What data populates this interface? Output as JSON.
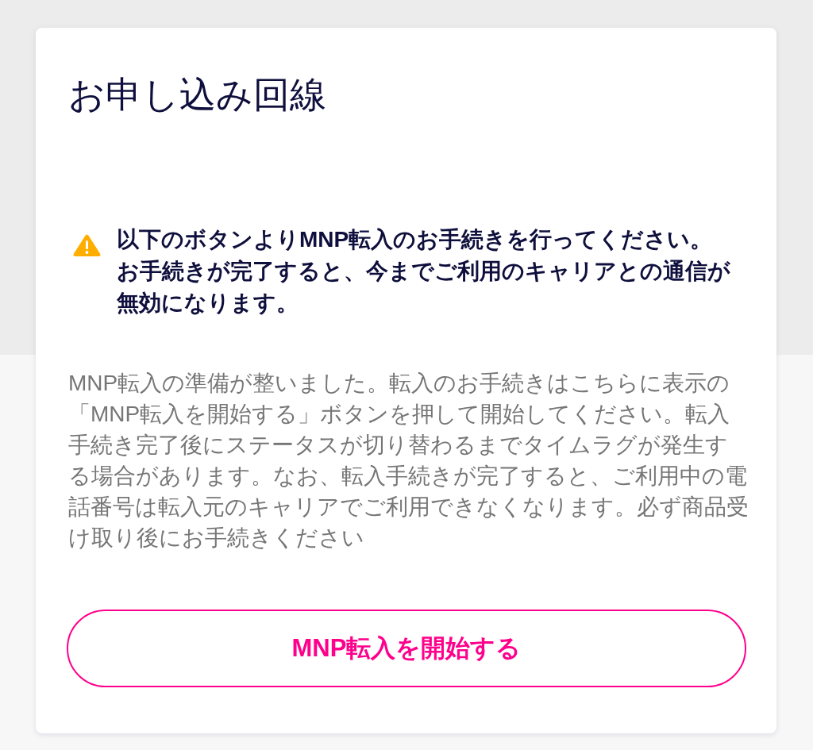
{
  "title": "お申し込み回線",
  "warning": {
    "lines": [
      "以下のボタンよりMNP転入のお手続きを行ってください。",
      "お手続きが完了すると、今までご利用のキャリアとの通信が無効になります。"
    ]
  },
  "description": "MNP転入の準備が整いました。転入のお手続きはこちらに表示の「MNP転入を開始する」ボタンを押して開始してください。転入手続き完了後にステータスが切り替わるまでタイムラグが発生する場合があります。なお、転入手続きが完了すると、ご利用中の電話番号は転入元のキャリアでご利用できなくなります。必ず商品受け取り後にお手続きください",
  "button": {
    "label": "MNP転入を開始する"
  }
}
